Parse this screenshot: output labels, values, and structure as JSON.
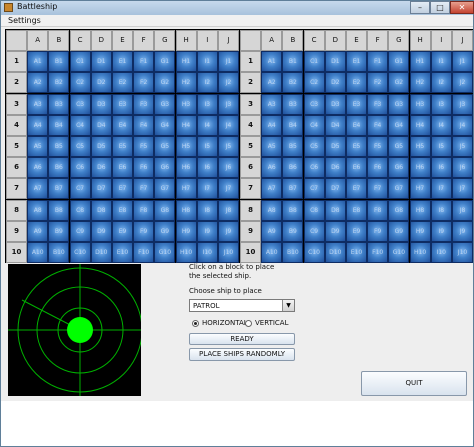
{
  "window": {
    "title": "Battleship",
    "minimize": "–",
    "maximize": "□",
    "close": "✕"
  },
  "menu": {
    "settings": "Settings"
  },
  "columns": [
    "A",
    "B",
    "C",
    "D",
    "E",
    "F",
    "G",
    "H",
    "I",
    "J"
  ],
  "rows": [
    "1",
    "2",
    "3",
    "4",
    "5",
    "6",
    "7",
    "8",
    "9",
    "10"
  ],
  "radar": {
    "color": "#00ff00",
    "background": "#000000"
  },
  "placement": {
    "info_line1": "Click on a block to place",
    "info_line2": "the selected ship.",
    "choose_label": "Choose ship to place",
    "ship_selected": "PATROL",
    "radio_horizontal": "HORIZONTAL",
    "radio_vertical": "VERTICAL",
    "horizontal_selected": true,
    "ready": "READY",
    "random": "PLACE SHIPS RANDOMLY"
  },
  "quit": "QUIT",
  "colors": {
    "water": "#2f63ad",
    "header": "#d6d6d6",
    "radar_dot": "#00ff00"
  }
}
